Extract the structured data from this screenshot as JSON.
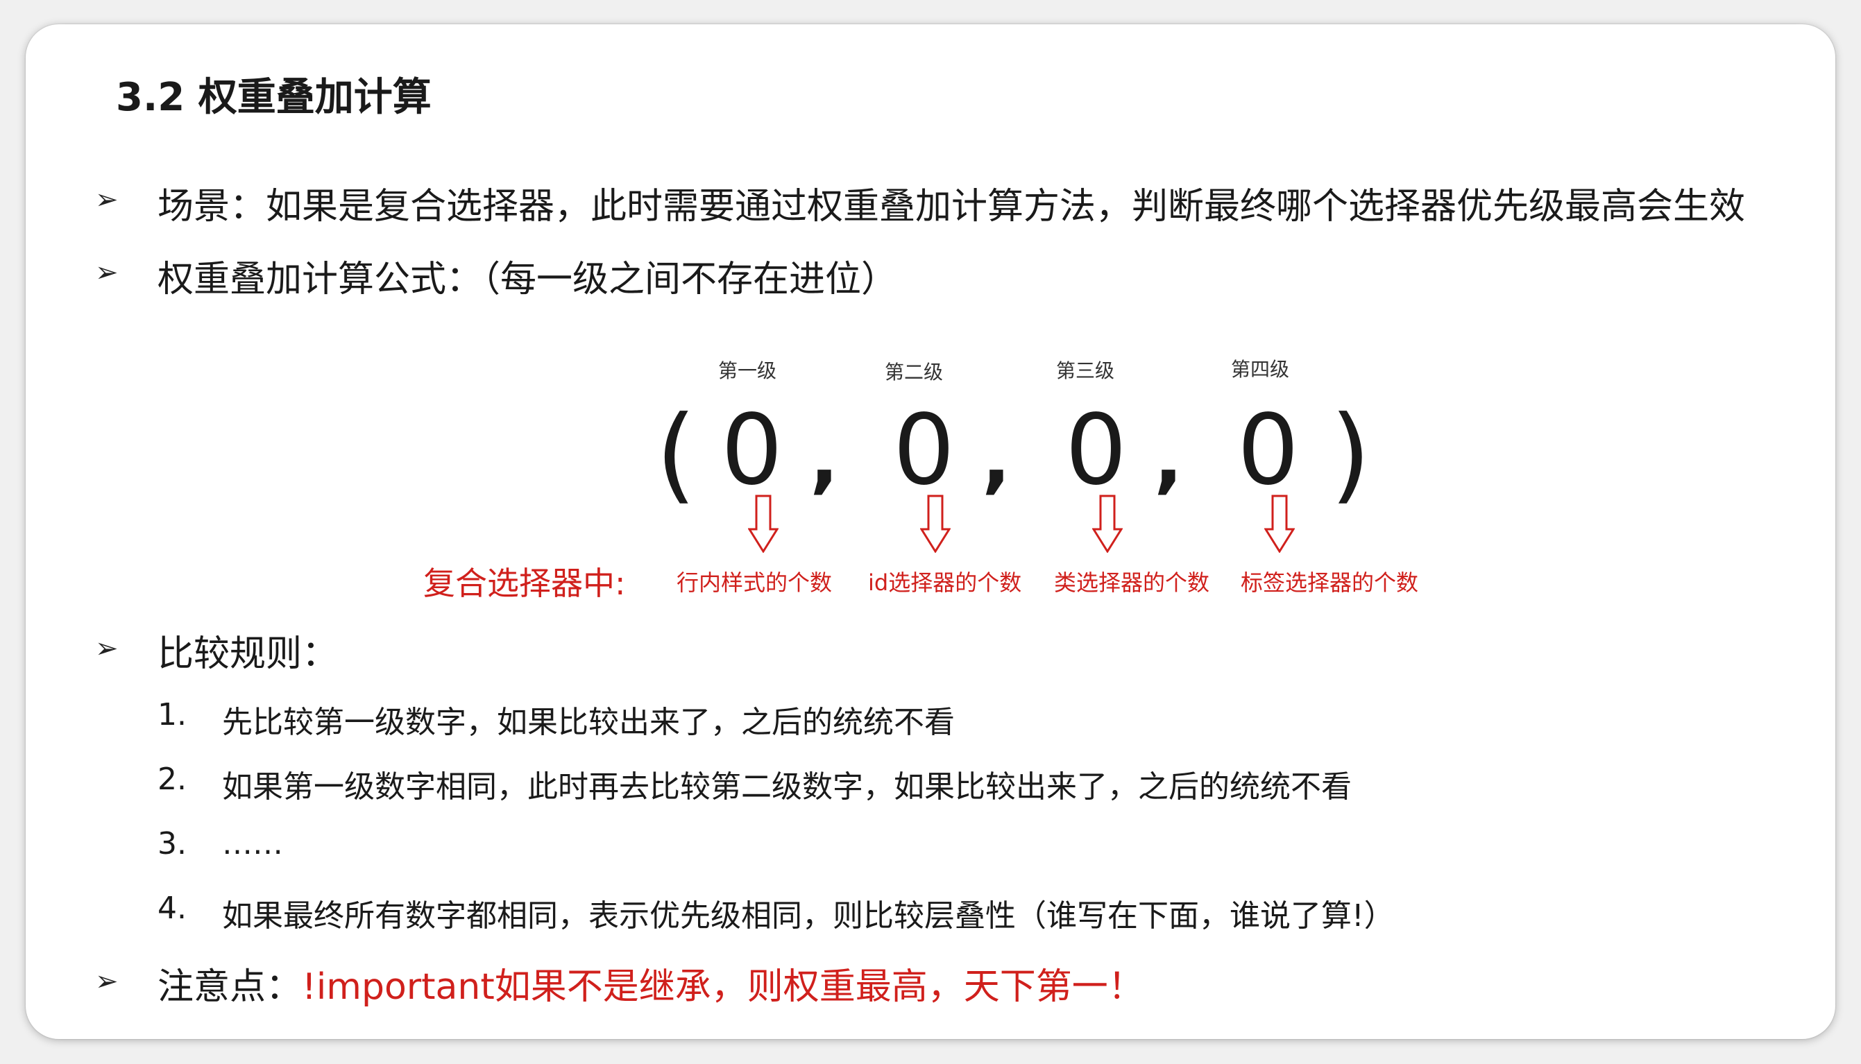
{
  "title": "3.2 权重叠加计算",
  "bullets": {
    "arrow": "➢",
    "b1": "场景：如果是复合选择器，此时需要通过权重叠加计算方法，判断最终哪个选择器优先级最高会生效",
    "b2": "权重叠加计算公式：（每一级之间不存在进位）",
    "b3": "比较规则：",
    "b4_prefix": "注意点：",
    "b4_red": "!important如果不是继承，则权重最高，天下第一！"
  },
  "formula": {
    "levels": [
      "第一级",
      "第二级",
      "第三级",
      "第四级"
    ],
    "open_paren": "(",
    "close_paren": ")",
    "values": [
      "0",
      "0",
      "0",
      "0"
    ],
    "comma": ",",
    "compound_label": "复合选择器中:",
    "meanings": [
      "行内样式的个数",
      "id选择器的个数",
      "类选择器的个数",
      "标签选择器的个数"
    ],
    "accent_color": "#d0201c"
  },
  "rules": [
    {
      "num": "1.",
      "text": "先比较第一级数字，如果比较出来了，之后的统统不看"
    },
    {
      "num": "2.",
      "text": "如果第一级数字相同，此时再去比较第二级数字，如果比较出来了，之后的统统不看"
    },
    {
      "num": "3.",
      "text": "……"
    },
    {
      "num": "4.",
      "text": "如果最终所有数字都相同，表示优先级相同，则比较层叠性（谁写在下面，谁说了算!）"
    }
  ]
}
